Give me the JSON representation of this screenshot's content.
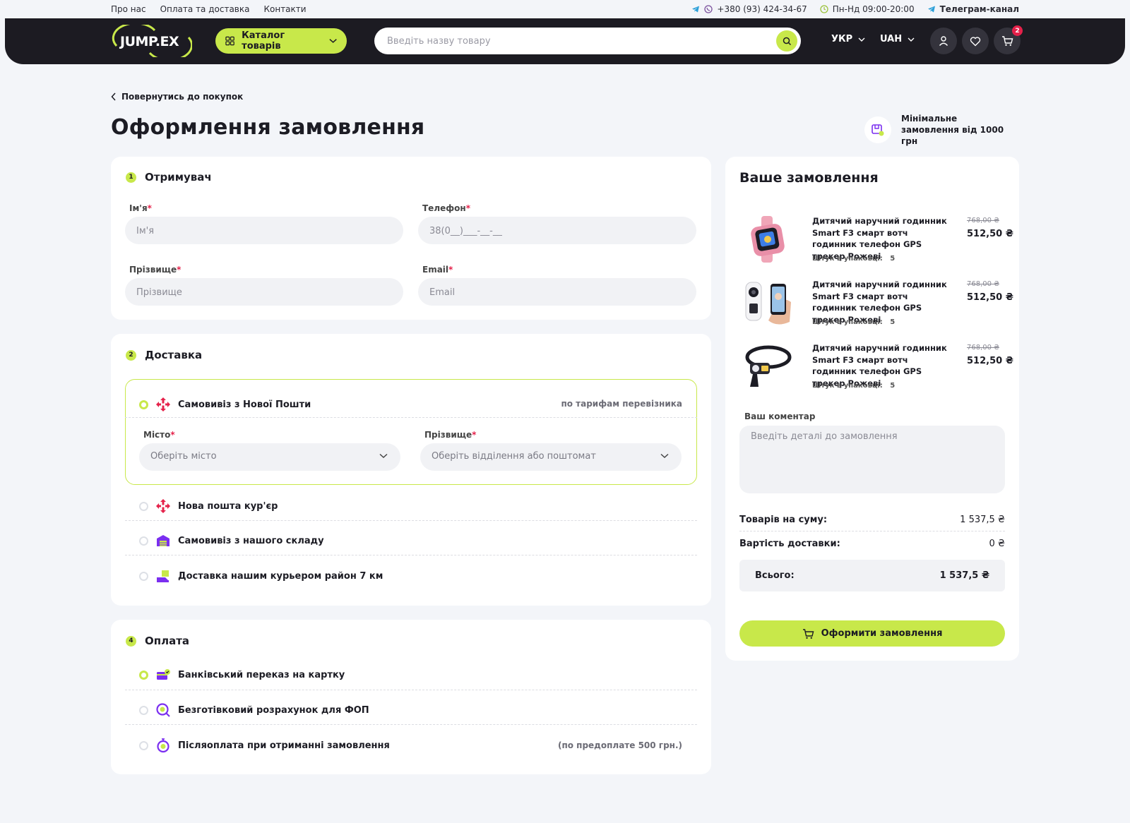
{
  "topbar": {
    "links": [
      "Про нас",
      "Оплата та доставка",
      "Контакти"
    ],
    "phone": "+380 (93) 424-34-67",
    "hours": "Пн-Нд 09:00-20:00",
    "telegram": "Телеграм-канал"
  },
  "header": {
    "logo_text": "JUMP.EX",
    "catalog_label": "Каталог товарів",
    "search_placeholder": "Введіть назву товару",
    "language": "УКР",
    "currency": "UAH",
    "cart_count": "2"
  },
  "page": {
    "back_label": "Повернутись до покупок",
    "title": "Оформлення замовлення",
    "min_order": "Мінімальне замовлення від 1000 грн"
  },
  "recipient": {
    "number": "1",
    "title": "Отримувач",
    "name_label": "Ім'я",
    "name_placeholder": "Ім'я",
    "phone_label": "Телефон",
    "phone_placeholder": "38(0__)___-__-__",
    "surname_label": "Прізвище",
    "surname_placeholder": "Прізвище",
    "email_label": "Email",
    "email_placeholder": "Email",
    "required_mark": "*"
  },
  "delivery": {
    "number": "2",
    "title": "Доставка",
    "options": [
      {
        "label": "Самовивіз з Нової Пошти",
        "note": "по тарифам перевізника",
        "selected": true,
        "icon": "nova-poshta-icon"
      },
      {
        "label": "Нова пошта кур'єр",
        "note": "",
        "selected": false,
        "icon": "nova-poshta-icon"
      },
      {
        "label": "Самовивіз з нашого складу",
        "note": "",
        "selected": false,
        "icon": "warehouse-icon"
      },
      {
        "label": "Доставка нашим курьером район 7 км",
        "note": "",
        "selected": false,
        "icon": "courier-icon"
      }
    ],
    "city_label": "Місто",
    "city_placeholder": "Оберіть місто",
    "branch_label": "Прізвище",
    "branch_placeholder": "Оберіть відділення або поштомат"
  },
  "payment": {
    "number": "4",
    "title": "Оплата",
    "options": [
      {
        "label": "Банківський переказ на картку",
        "note": "",
        "selected": true,
        "icon": "card-transfer-icon"
      },
      {
        "label": "Безготівковий розрахунок для ФОП",
        "note": "",
        "selected": false,
        "icon": "cashless-icon"
      },
      {
        "label": "Післяоплата при отриманні замовлення",
        "note": "(по предоплате 500 грн.)",
        "selected": false,
        "icon": "cash-on-delivery-icon"
      }
    ]
  },
  "order": {
    "title": "Ваше замовлення",
    "items": [
      {
        "name": "Дитячий наручний годинник Smart F3 смарт вотч годинник телефон GPS трекер Рожеві",
        "qty_label": "Штук в упаковці:",
        "qty": "5",
        "old_price": "768,00 ₴",
        "price": "512,50 ₴",
        "image": "smartwatch-image"
      },
      {
        "name": "Дитячий наручний годинник Smart F3 смарт вотч годинник телефон GPS трекер Рожеві",
        "qty_label": "Штук в упаковці:",
        "qty": "5",
        "old_price": "768,00 ₴",
        "price": "512,50 ₴",
        "image": "camera-phone-image"
      },
      {
        "name": "Дитячий наручний годинник Smart F3 смарт вотч годинник телефон GPS трекер Рожеві",
        "qty_label": "Штук в упаковці:",
        "qty": "5",
        "old_price": "768,00 ₴",
        "price": "512,50 ₴",
        "image": "headlamp-image"
      }
    ],
    "comment_label": "Ваш коментар",
    "comment_placeholder": "Введіть деталі до замовлення",
    "goods_sum_label": "Товарів на суму:",
    "goods_sum": "1 537,5 ₴",
    "delivery_cost_label": "Вартість доставки:",
    "delivery_cost": "0 ₴",
    "total_label": "Всього:",
    "total": "1 537,5 ₴",
    "checkout_label": "Оформити замовлення"
  },
  "colors": {
    "accent": "#c8e84a",
    "header": "#1c1b22",
    "required": "#e5214a",
    "background": "#f3f5f9"
  }
}
